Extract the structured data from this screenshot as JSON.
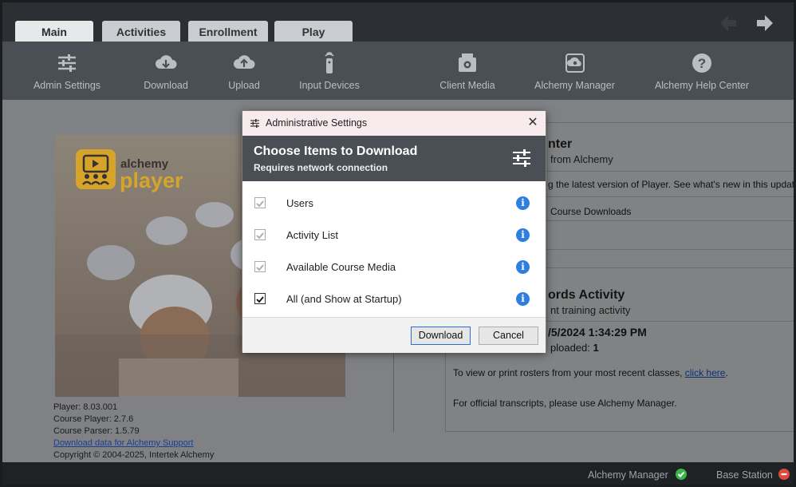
{
  "tabs": [
    "Main",
    "Activities",
    "Enrollment",
    "Play"
  ],
  "toolbar": {
    "items": [
      {
        "label": "Admin Settings",
        "icon": "sliders-icon"
      },
      {
        "label": "Download",
        "icon": "cloud-download-icon"
      },
      {
        "label": "Upload",
        "icon": "cloud-upload-icon"
      },
      {
        "label": "Input Devices",
        "icon": "remote-icon"
      },
      {
        "label": "Client Media",
        "icon": "media-icon"
      },
      {
        "label": "Alchemy Manager",
        "icon": "cloud-gear-icon"
      },
      {
        "label": "Alchemy Help Center",
        "icon": "help-icon"
      }
    ]
  },
  "logo": {
    "brand": "alchemy",
    "product": "player"
  },
  "player_info": {
    "player": "Player: 8.03.001",
    "course_player": "Course Player: 2.7.6",
    "course_parser": "Course Parser: 1.5.79",
    "support_link": "Download data for Alchemy Support",
    "copyright": "Copyright © 2004-2025, Intertek Alchemy"
  },
  "card1": {
    "title": "nter",
    "subtitle": "from Alchemy",
    "line1": "g the latest version of Player. See what's new in this update",
    "line2": "Course Downloads"
  },
  "card2": {
    "title": "ords Activity",
    "subtitle": "nt training activity",
    "datetime": "/5/2024 1:34:29 PM",
    "uploaded_label": "ploaded:",
    "uploaded_value": "1",
    "roster_text": "To view or print rosters from your most recent classes,",
    "roster_link": "click here",
    "roster_end": ".",
    "transcripts_text": "For official transcripts, please use Alchemy Manager."
  },
  "status": {
    "manager_label": "Alchemy Manager",
    "manager_color": "#3bb54a",
    "base_label": "Base Station",
    "base_color": "#e04a3a"
  },
  "dialog": {
    "window_title": "Administrative Settings",
    "heading": "Choose Items to Download",
    "subheading": "Requires network connection",
    "options": [
      {
        "label": "Users",
        "checked": true,
        "disabled": true
      },
      {
        "label": "Activity List",
        "checked": true,
        "disabled": true
      },
      {
        "label": "Available Course Media",
        "checked": true,
        "disabled": true
      },
      {
        "label": "All (and Show at Startup)",
        "checked": true,
        "disabled": false
      }
    ],
    "download_button": "Download",
    "cancel_button": "Cancel"
  }
}
